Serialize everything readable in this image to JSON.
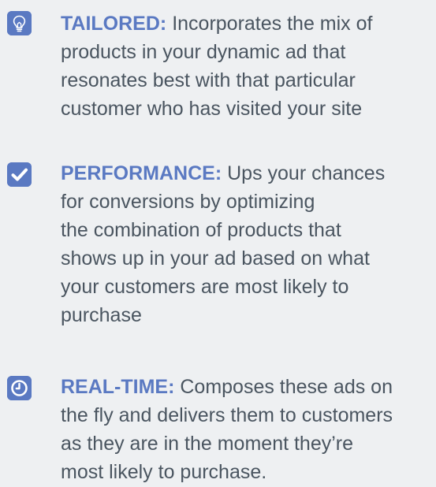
{
  "features": [
    {
      "icon": "lightbulb-icon",
      "label": "TAILORED:",
      "lines": [
        " Incorporates the mix of",
        "products in your dynamic ad that",
        "resonates best with that particular",
        "customer who has visited your site"
      ]
    },
    {
      "icon": "checkmark-icon",
      "label": "PERFORMANCE:",
      "lines": [
        " Ups your chances",
        "for conversions by optimizing",
        "the combination of products that",
        "shows up in your ad based on what",
        "your customers are most likely to",
        "purchase"
      ]
    },
    {
      "icon": "clock-icon",
      "label": "REAL-TIME:",
      "lines": [
        " Composes these ads on",
        "the fly and delivers them to customers",
        "as they are in the moment they’re",
        "most likely to purchase."
      ]
    }
  ],
  "colors": {
    "accent": "#5a79c2",
    "text": "#4a5560",
    "background": "#eef0f2"
  }
}
